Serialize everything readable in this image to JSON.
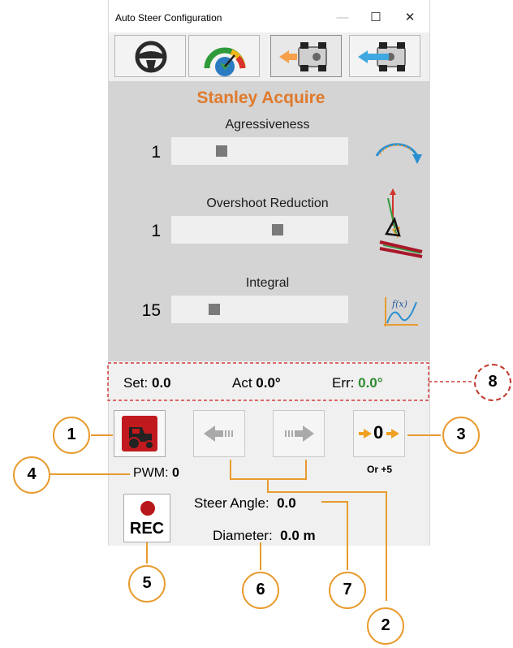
{
  "window": {
    "title": "Auto Steer Configuration",
    "minimize_glyph": "—",
    "maximize_glyph": "☐",
    "close_glyph": "✕"
  },
  "tabs": [
    {
      "icon": "steering-wheel-icon",
      "active": false
    },
    {
      "icon": "gauge-icon",
      "active": false
    },
    {
      "icon": "tractor-rear-steer-icon",
      "active": true
    },
    {
      "icon": "tractor-front-steer-icon",
      "active": false
    }
  ],
  "panel": {
    "title": "Stanley Acquire",
    "sliders": [
      {
        "label": "Agressiveness",
        "value": "1",
        "icon": "arc-arrow-icon"
      },
      {
        "label": "Overshoot Reduction",
        "value": "1",
        "icon": "overshoot-vector-icon"
      },
      {
        "label": "Integral",
        "value": "15",
        "icon": "function-graph-icon"
      }
    ]
  },
  "status": {
    "set_label": "Set:",
    "set_value": "0.0",
    "act_label": "Act",
    "act_value": "0.0°",
    "err_label": "Err:",
    "err_value": "0.0°",
    "err_color": "#2e8b2e"
  },
  "controls": {
    "engage_icon": "tractor-engage-icon",
    "left_icon": "arrow-left-icon",
    "right_icon": "arrow-right-icon",
    "zero_icon": "zero-center-icon",
    "zero_text": "0",
    "zero_hint": "Or +5",
    "pwm_label": "PWM:",
    "pwm_value": "0",
    "rec_label": "REC",
    "steer_angle_label": "Steer Angle:",
    "steer_angle_value": "0.0",
    "diameter_label": "Diameter:",
    "diameter_value": "0.0 m"
  },
  "callouts": [
    "1",
    "2",
    "3",
    "4",
    "5",
    "6",
    "7",
    "8"
  ],
  "colors": {
    "accent": "#e07a2c",
    "engage_red": "#b8181c",
    "callout_ring": "#e89b2e"
  }
}
